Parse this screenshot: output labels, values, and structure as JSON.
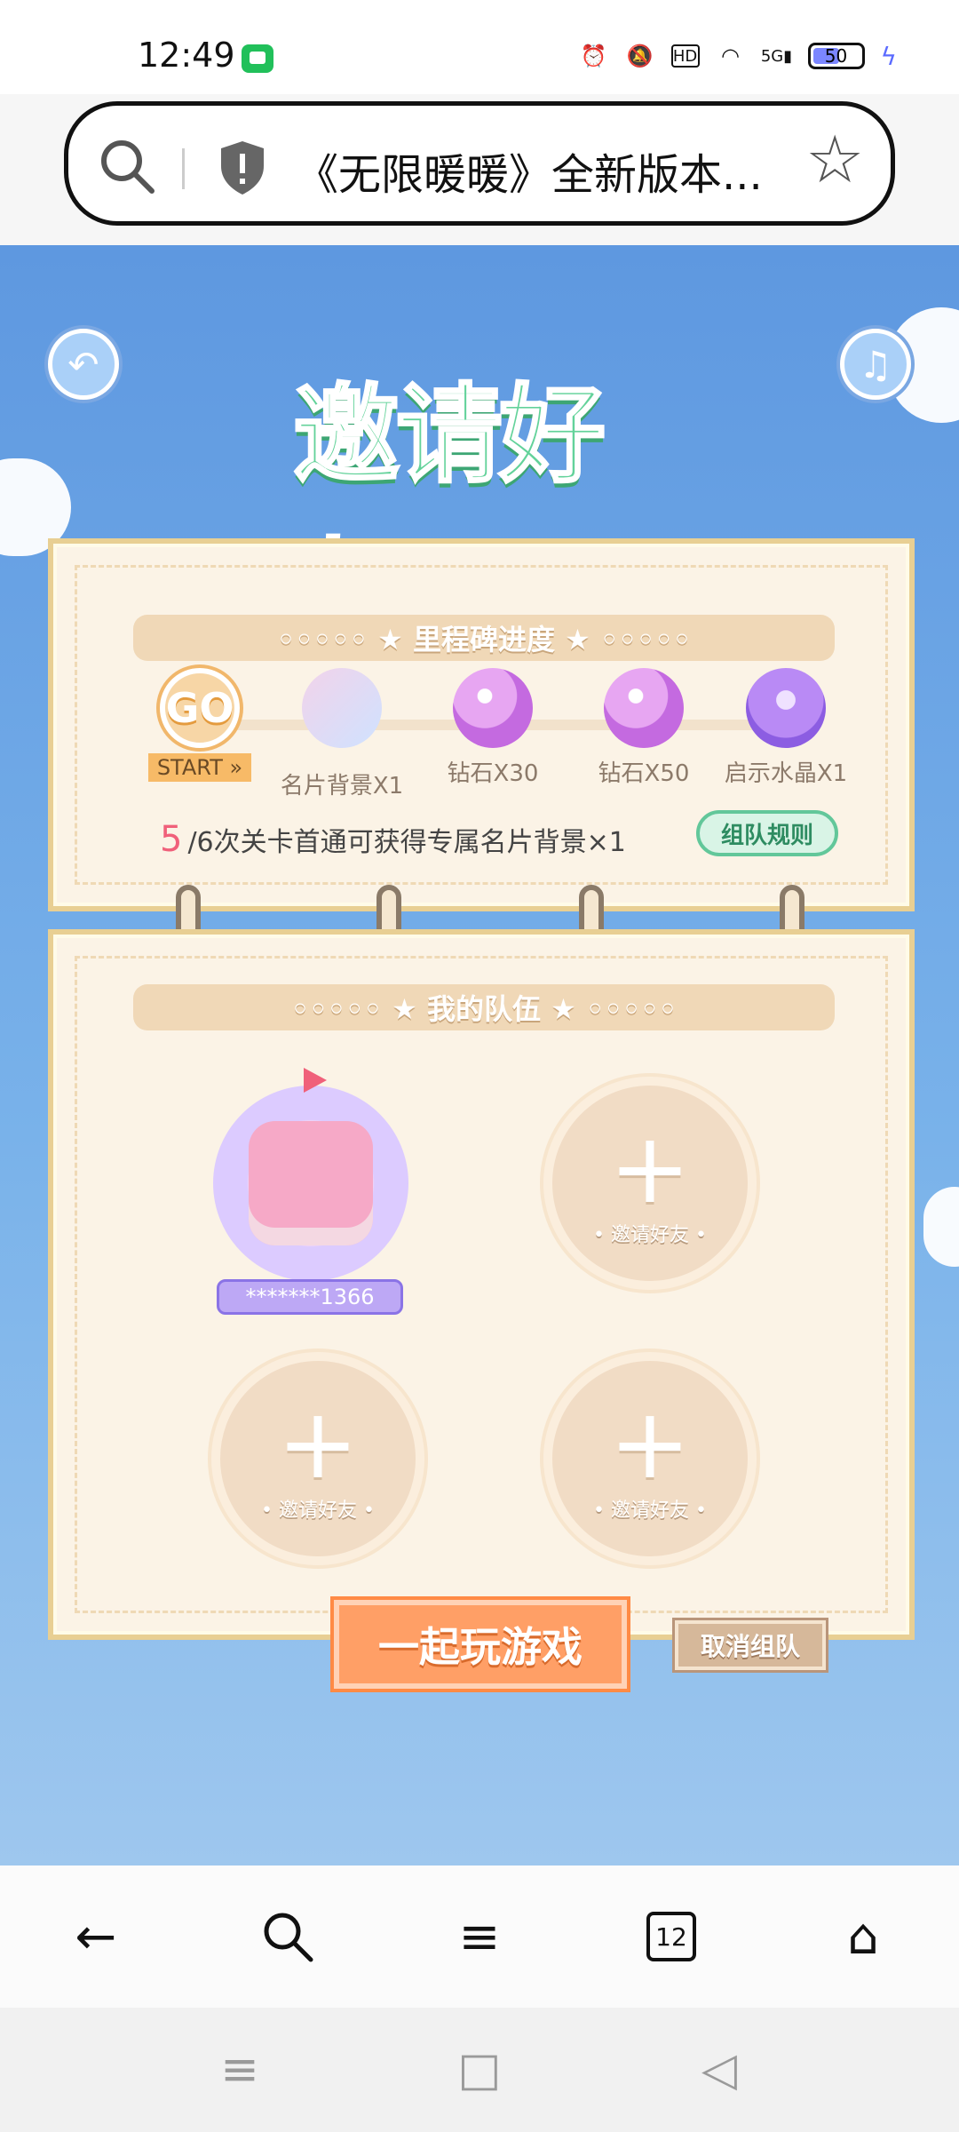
{
  "status_bar": {
    "time": "12:49",
    "icons": [
      "alarm-icon",
      "mute-icon",
      "hd-icon",
      "wifi-icon",
      "5g-signal-icon"
    ],
    "battery_level": "50"
  },
  "browser": {
    "page_title": "《无限暖暖》全新版本...",
    "bottom_nav": {
      "tabs_count": "12",
      "icons": [
        "back-arrow-icon",
        "search-icon",
        "menu-icon",
        "tabs-icon",
        "home-icon"
      ]
    }
  },
  "game": {
    "title": "邀请好友",
    "milestone_header": "◦◦◦◦◦ ★ 里程碑进度 ★ ◦◦◦◦◦",
    "milestones": [
      {
        "label": "START »",
        "icon": "go"
      },
      {
        "label": "名片背景X1",
        "icon": "card-bg"
      },
      {
        "label": "钻石X30",
        "icon": "diamond"
      },
      {
        "label": "钻石X50",
        "icon": "diamond"
      },
      {
        "label": "启示水晶X1",
        "icon": "crystal"
      }
    ],
    "go_text": "GO",
    "progress_number": "5",
    "progress_text": "/6次关卡首通可获得专属名片背景×1",
    "rule_button": "组队规则",
    "team_header": "◦◦◦◦◦ ★ 我的队伍 ★ ◦◦◦◦◦",
    "member_name": "*******1366",
    "invite_label": "• 邀请好友 •",
    "play_button": "一起玩游戏",
    "cancel_button": "取消组队"
  },
  "colors": {
    "sky_top": "#5e98e0",
    "panel_bg": "#fbf3e6",
    "title_green": "#63d29a",
    "play_orange": "#ff9f66",
    "progress_pink": "#f0607a"
  }
}
